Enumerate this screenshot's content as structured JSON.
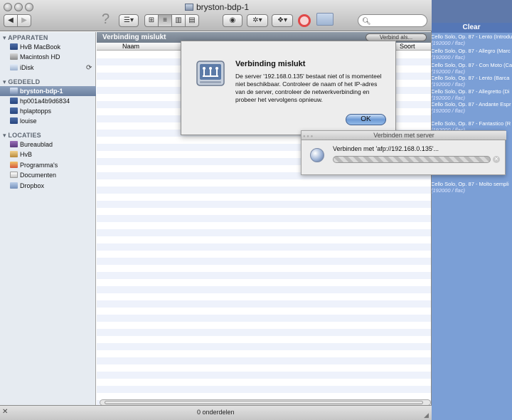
{
  "window": {
    "title": "bryston-bdp-1"
  },
  "toolbar": {
    "back_label": "◀",
    "forward_label": "▶",
    "help_label": "?",
    "search_placeholder": ""
  },
  "sidebar": {
    "sections": [
      {
        "heading": "APPARATEN",
        "items": [
          {
            "label": "HvB MacBook"
          },
          {
            "label": "Macintosh HD"
          },
          {
            "label": "iDisk"
          }
        ]
      },
      {
        "heading": "GEDEELD",
        "items": [
          {
            "label": "bryston-bdp-1"
          },
          {
            "label": "hp001a4b9d6834"
          },
          {
            "label": "hplaptopps"
          },
          {
            "label": "louise"
          }
        ]
      },
      {
        "heading": "LOCATIES",
        "items": [
          {
            "label": "Bureaublad"
          },
          {
            "label": "HvB"
          },
          {
            "label": "Programma's"
          },
          {
            "label": "Documenten"
          },
          {
            "label": "Dropbox"
          }
        ]
      }
    ]
  },
  "content": {
    "path_title": "Verbinding mislukt",
    "connect_as_label": "Verbind als...",
    "columns": {
      "name": "Naam",
      "kind": "Soort"
    }
  },
  "status": {
    "item_count": "0 onderdelen"
  },
  "alert": {
    "title": "Verbinding mislukt",
    "message": "De server '192.168.0.135' bestaat niet of is momenteel niet beschikbaar. Controleer de naam of het IP-adres van de server, controleer de netwerkverbinding en probeer het vervolgens opnieuw.",
    "ok_label": "OK"
  },
  "connect_panel": {
    "title": "Verbinden met server",
    "label": "Verbinden met 'afp://192.168.0.135'..."
  },
  "background_list": {
    "header": "Clear",
    "tracks": [
      {
        "title": "Cello Solo, Op. 87 - Lento (Introdu",
        "format": "(192000 / flac)"
      },
      {
        "title": "Cello Solo, Op. 87 - Allegro (Marc",
        "format": "(192000 / flac)"
      },
      {
        "title": "Cello Solo, Op. 87 - Con Moto (Ca",
        "format": "(192000 / flac)"
      },
      {
        "title": "Cello Solo, Op. 87 - Lento (Barca",
        "format": "(192000 / flac)"
      },
      {
        "title": "Cello Solo, Op. 87 - Allegretto (Di",
        "format": "(192000 / flac)"
      },
      {
        "title": "Cello Solo, Op. 87 - Andante Espr",
        "format": "(192000 / flac)"
      },
      {
        "title": "Cello Solo, Op. 87 - Fantastico (R",
        "format": "(192000 / flac)"
      },
      {
        "title": "Cello Solo, Op. 87 - Molto sempli",
        "format": "(192000 / flac)"
      }
    ]
  }
}
